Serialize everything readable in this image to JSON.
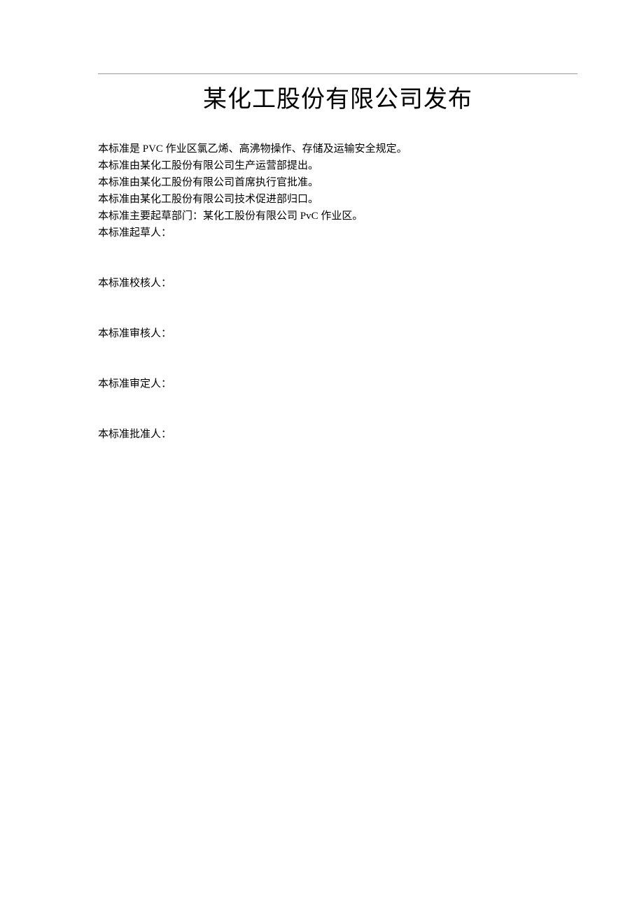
{
  "title": "某化工股份有限公司发布",
  "paragraphs": {
    "p1": "本标准是 PVC 作业区氯乙烯、高沸物操作、存储及运输安全规定。",
    "p2": "本标准由某化工股份有限公司生产运营部提出。",
    "p3": "本标准由某化工股份有限公司首席执行官批准。",
    "p4": "本标准由某化工股份有限公司技术促进部归口。",
    "p5": "本标准主要起草部门：某化工股份有限公司 PvC 作业区。",
    "p6": "本标准起草人：",
    "p7": "本标准校核人：",
    "p8": "本标准审核人：",
    "p9": "本标准审定人：",
    "p10": "本标准批准人："
  }
}
